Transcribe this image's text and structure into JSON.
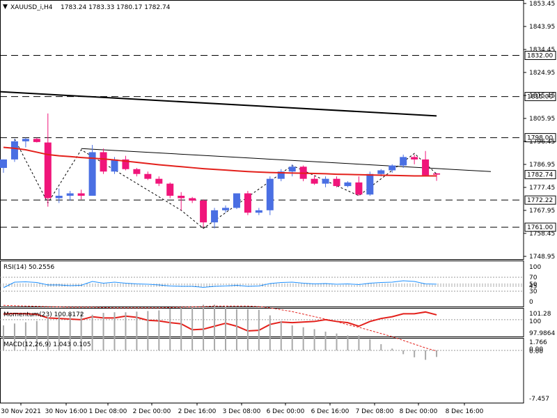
{
  "header": {
    "symbol": "XAUUSD_i,H4",
    "ohlc": "1783.24 1783.33 1780.17 1782.74"
  },
  "colors": {
    "bull": "#4a6fe3",
    "bear": "#f0157a",
    "ma_red": "#e3201b",
    "ma_black": "#000000",
    "rsi": "#1e90ff",
    "momentum": "#e3201b",
    "macd_signal": "#e3201b",
    "macd_hist": "#a9a9a9",
    "label_bg": "#ffffff"
  },
  "chart_data": [
    {
      "type": "candlestick",
      "title": "XAUUSD_i,H4 1783.24 1783.33 1780.17 1782.74",
      "ylim": [
        1748.95,
        1853.45
      ],
      "y_ticks": [
        "1853.45",
        "1843.95",
        "1834.45",
        "1824.95",
        "1815.45",
        "1805.95",
        "1796.45",
        "1786.95",
        "1777.45",
        "1767.95",
        "1758.45",
        "1748.95"
      ],
      "x_ticks": [
        "30 Nov 2021",
        "30 Nov 16:00",
        "1 Dec 08:00",
        "2 Dec 00:00",
        "2 Dec 16:00",
        "3 Dec 08:00",
        "6 Dec 00:00",
        "6 Dec 16:00",
        "7 Dec 08:00",
        "8 Dec 00:00",
        "8 Dec 16:00"
      ],
      "levels": [
        {
          "value": 1832.0,
          "label": "1832.00"
        },
        {
          "value": 1815.0,
          "label": "1815.00"
        },
        {
          "value": 1798.0,
          "label": "1798.00"
        },
        {
          "value": 1772.22,
          "label": "1772.22"
        },
        {
          "value": 1761.0,
          "label": "1761.00"
        }
      ],
      "last_price": {
        "value": 1782.74,
        "label": "1782.74"
      },
      "candles": [
        [
          1785.5,
          1789.0,
          1783.5,
          1789.0
        ],
        [
          1789.0,
          1797.5,
          1788.0,
          1796.5
        ],
        [
          1796.5,
          1798.0,
          1794.0,
          1797.5
        ],
        [
          1797.5,
          1798.0,
          1796.0,
          1796.2
        ],
        [
          1796.0,
          1808.0,
          1769.5,
          1773.0
        ],
        [
          1773.0,
          1777.0,
          1771.0,
          1774.0
        ],
        [
          1774.0,
          1776.0,
          1772.0,
          1775.0
        ],
        [
          1775.0,
          1776.5,
          1772.5,
          1774.0
        ],
        [
          1774.0,
          1795.0,
          1774.0,
          1792.0
        ],
        [
          1792.0,
          1793.5,
          1783.0,
          1784.0
        ],
        [
          1784.0,
          1790.0,
          1783.0,
          1789.0
        ],
        [
          1789.0,
          1790.5,
          1784.5,
          1785.0
        ],
        [
          1785.0,
          1785.5,
          1782.0,
          1783.0
        ],
        [
          1783.0,
          1784.0,
          1780.5,
          1781.0
        ],
        [
          1781.0,
          1782.0,
          1778.0,
          1779.0
        ],
        [
          1779.0,
          1779.5,
          1773.0,
          1774.0
        ],
        [
          1774.0,
          1775.5,
          1768.0,
          1773.0
        ],
        [
          1773.0,
          1773.5,
          1771.0,
          1772.0
        ],
        [
          1772.0,
          1772.5,
          1761.0,
          1763.0
        ],
        [
          1763.0,
          1769.0,
          1760.5,
          1768.0
        ],
        [
          1768.0,
          1770.0,
          1767.0,
          1769.0
        ],
        [
          1769.0,
          1775.0,
          1768.5,
          1775.0
        ],
        [
          1775.0,
          1776.0,
          1766.0,
          1767.0
        ],
        [
          1767.0,
          1769.0,
          1766.0,
          1768.0
        ],
        [
          1768.0,
          1782.0,
          1766.0,
          1781.0
        ],
        [
          1781.0,
          1785.0,
          1780.0,
          1784.0
        ],
        [
          1784.0,
          1787.0,
          1782.0,
          1786.0
        ],
        [
          1786.0,
          1786.5,
          1780.0,
          1781.0
        ],
        [
          1781.0,
          1782.5,
          1778.5,
          1779.0
        ],
        [
          1779.0,
          1782.0,
          1777.5,
          1781.0
        ],
        [
          1781.0,
          1782.0,
          1777.5,
          1778.0
        ],
        [
          1778.0,
          1780.0,
          1777.5,
          1779.5
        ],
        [
          1779.5,
          1782.0,
          1774.0,
          1774.5
        ],
        [
          1774.5,
          1784.0,
          1774.0,
          1783.0
        ],
        [
          1783.0,
          1785.0,
          1782.0,
          1784.5
        ],
        [
          1784.5,
          1787.0,
          1783.5,
          1786.5
        ],
        [
          1786.5,
          1791.0,
          1785.5,
          1790.0
        ],
        [
          1790.0,
          1791.0,
          1787.0,
          1789.0
        ],
        [
          1789.0,
          1792.5,
          1782.0,
          1782.5
        ],
        [
          1783.24,
          1783.33,
          1780.17,
          1782.74
        ]
      ],
      "ma_red": [
        1794.0,
        1793.6,
        1793.0,
        1792.0,
        1791.0,
        1790.5,
        1790.2,
        1789.8,
        1789.5,
        1789.2,
        1788.8,
        1788.3,
        1787.8,
        1787.3,
        1786.8,
        1786.4,
        1786.0,
        1785.6,
        1785.2,
        1784.9,
        1784.6,
        1784.3,
        1784.0,
        1783.8,
        1783.6,
        1783.5,
        1783.4,
        1783.3,
        1783.2,
        1783.1,
        1782.9,
        1782.8,
        1782.7,
        1782.6,
        1782.5,
        1782.4,
        1782.3,
        1782.2,
        1782.2,
        1782.2
      ],
      "ma_black": [
        1817.0,
        1807.0
      ],
      "trend_line": [
        1793.5,
        1784.0
      ],
      "zigzag": [
        [
          1,
          1797.5
        ],
        [
          4,
          1771.0
        ],
        [
          7,
          1793.0
        ],
        [
          16,
          1768.0
        ],
        [
          18,
          1760.5
        ],
        [
          26,
          1786.5
        ],
        [
          32,
          1774.0
        ],
        [
          37,
          1791.5
        ],
        [
          39,
          1783.0
        ]
      ]
    },
    {
      "type": "line",
      "title": "RSI(14) 50.2556",
      "ylim": [
        0,
        100
      ],
      "y_ticks": [
        "100",
        "70",
        "50",
        "45",
        "30",
        "0"
      ],
      "levels": [
        70,
        50,
        45,
        30
      ],
      "series": [
        {
          "name": "RSI(14)",
          "values": [
            40,
            56,
            57,
            55,
            48,
            48,
            46,
            47,
            58,
            53,
            56,
            53,
            51,
            50,
            48,
            45,
            44,
            44,
            41,
            44,
            45,
            47,
            44,
            45,
            52,
            55,
            56,
            53,
            51,
            52,
            50,
            51,
            49,
            53,
            55,
            56,
            60,
            58,
            51,
            50.2556
          ]
        }
      ]
    },
    {
      "type": "line",
      "title": "Momentum(23) 100.8172",
      "y_ticks": [
        "101.28",
        "100",
        "97.9864"
      ],
      "series": [
        {
          "name": "Momentum(23)",
          "values": [
            100.95,
            101.05,
            101.0,
            100.9,
            100.3,
            100.2,
            100.1,
            100.0,
            100.5,
            100.3,
            100.3,
            100.6,
            100.4,
            99.9,
            99.8,
            99.5,
            99.3,
            98.3,
            98.4,
            98.9,
            99.4,
            98.9,
            98.1,
            98.2,
            99.2,
            99.6,
            99.5,
            99.6,
            99.7,
            100.0,
            99.7,
            99.5,
            98.9,
            99.7,
            100.2,
            100.5,
            101.0,
            101.0,
            101.3,
            100.8172
          ]
        }
      ]
    },
    {
      "type": "bar",
      "title": "MACD(12,26,9) 1.043 0.105",
      "y_ticks": [
        "1.766",
        "0.00",
        "0.00",
        "-7.457"
      ],
      "series": [
        {
          "name": "MACD(12,26,9)",
          "values": [
            -4.0,
            -4.3,
            -4.5,
            -4.7,
            -5.3,
            -5.6,
            -5.9,
            -6.1,
            -5.7,
            -6.0,
            -6.1,
            -6.1,
            -6.2,
            -6.3,
            -6.4,
            -6.7,
            -6.9,
            -7.0,
            -7.3,
            -7.3,
            -7.0,
            -6.6,
            -6.6,
            -6.5,
            -5.6,
            -4.7,
            -4.0,
            -3.7,
            -3.4,
            -3.0,
            -2.7,
            -2.4,
            -2.4,
            -1.8,
            -1.0,
            -0.3,
            0.6,
            1.1,
            1.5,
            1.043
          ]
        },
        {
          "name": "signal",
          "values": [
            -7.2,
            -7.15,
            -7.1,
            -7.05,
            -7.0,
            -6.95,
            -6.9,
            -6.9,
            -6.9,
            -6.85,
            -6.8,
            -6.8,
            -6.8,
            -6.8,
            -6.8,
            -6.85,
            -6.9,
            -6.95,
            -7.0,
            -7.1,
            -7.1,
            -7.1,
            -7.1,
            -7.0,
            -6.8,
            -6.5,
            -6.2,
            -5.8,
            -5.4,
            -5.0,
            -4.6,
            -4.1,
            -3.7,
            -3.2,
            -2.7,
            -2.2,
            -1.6,
            -1.0,
            -0.4,
            0.105
          ]
        }
      ]
    }
  ]
}
